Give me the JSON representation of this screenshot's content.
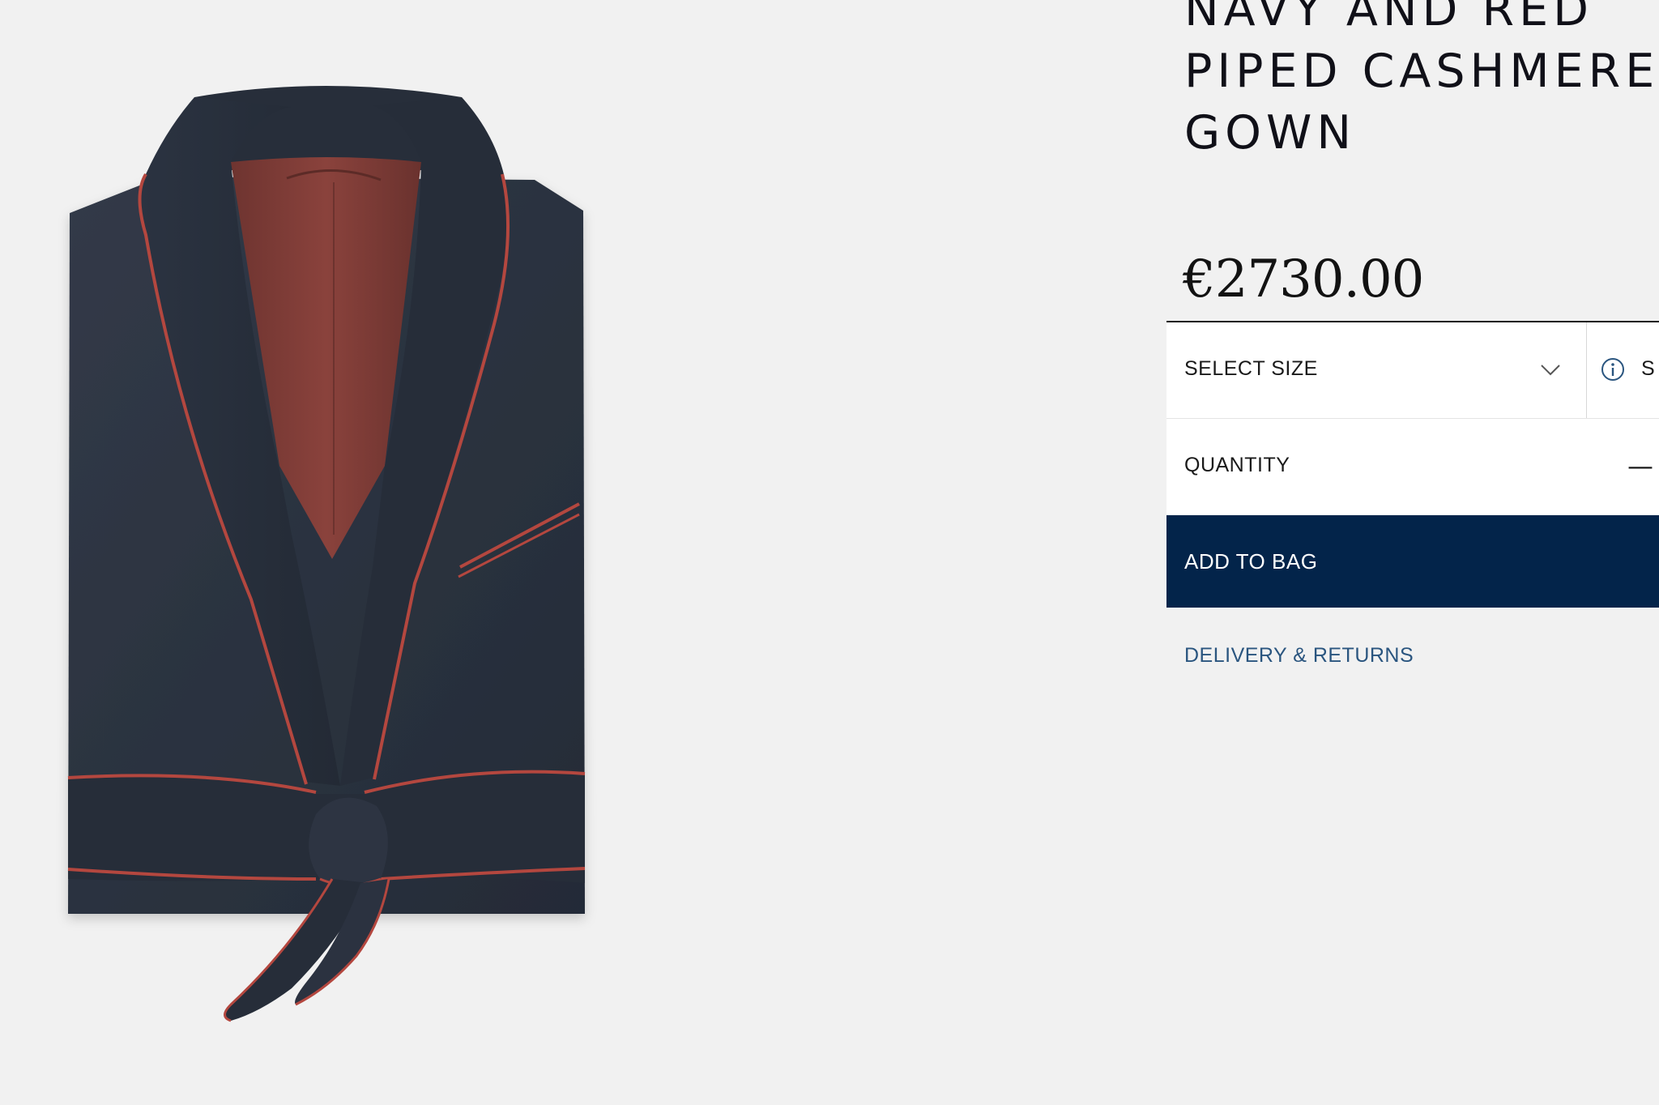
{
  "product": {
    "title": "NAVY AND RED\nPIPED CASHMERE\nGOWN",
    "price": "€2730.00",
    "image_alt": "Navy cashmere dressing gown with red piping and belt"
  },
  "form": {
    "size_label": "SELECT SIZE",
    "size_guide_label": "S",
    "quantity_label": "QUANTITY",
    "quantity_minus": "—",
    "add_to_bag_label": "ADD TO BAG"
  },
  "links": {
    "delivery_returns": "DELIVERY & RETURNS"
  },
  "colors": {
    "background": "#f1f1f1",
    "button_navy": "#03244a",
    "link_blue": "#2a557f",
    "robe_navy": "#2a3240",
    "piping_red": "#b4473f",
    "lining_red": "#7d3a35"
  },
  "icons": {
    "size_dropdown": "chevron-down-icon",
    "size_guide": "info-icon"
  }
}
